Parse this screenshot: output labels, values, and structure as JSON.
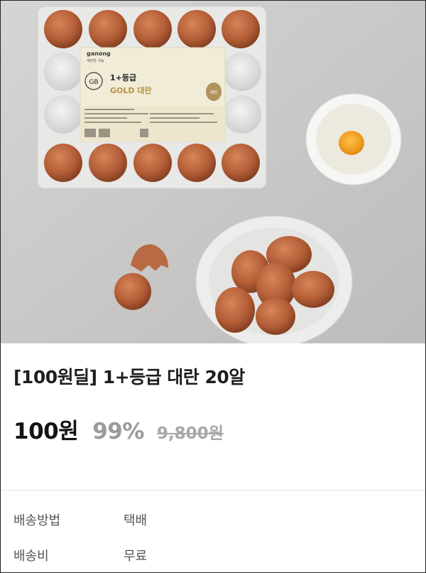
{
  "product": {
    "image_alt": "1+등급 GOLD 대란 계란 트레이",
    "package_label": {
      "brand": "ganong",
      "brand_sub": "계란은 가농",
      "grade": "1+등급",
      "name": "GOLD 대란",
      "size_badge": "대란",
      "badge_gb": "GB"
    },
    "title": "[100원딜] 1+등급 대란 20알",
    "price": "100원",
    "discount": "99%",
    "original_price": "9,800원"
  },
  "shipping": {
    "method_label": "배송방법",
    "method_value": "택배",
    "fee_label": "배송비",
    "fee_value": "무료"
  }
}
